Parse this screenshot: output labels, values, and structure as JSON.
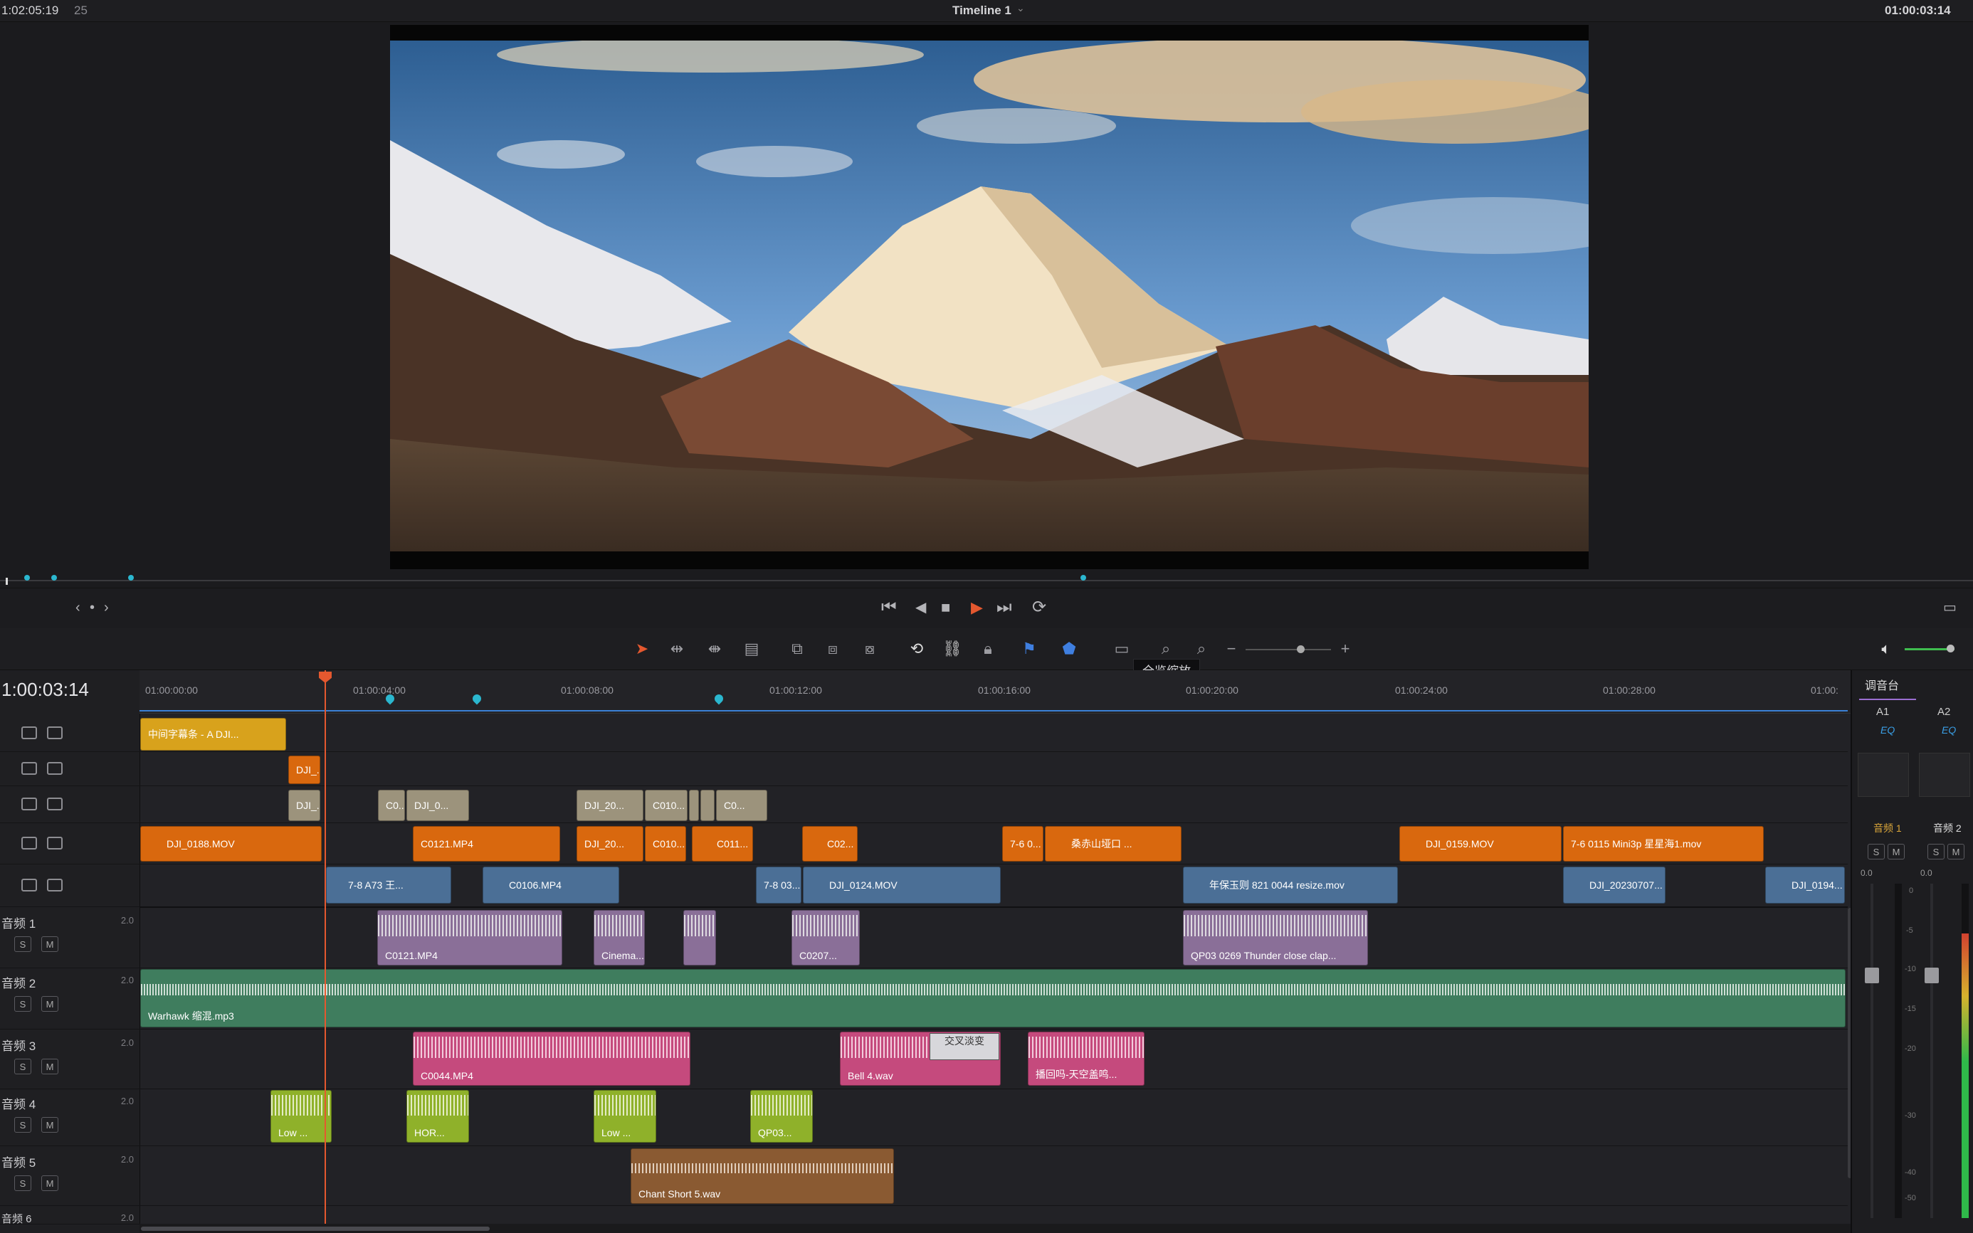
{
  "topbar": {
    "left_timecode": "1:02:05:19",
    "frame_count": "25",
    "timeline_name": "Timeline 1",
    "right_timecode": "01:00:03:14"
  },
  "viewer": {
    "image_description_icon": "mountain-landscape-image"
  },
  "transport": {
    "nav_prev": "‹",
    "nav_dot": "•",
    "nav_next": "›"
  },
  "tooltip": {
    "text": "全览缩放"
  },
  "timeline": {
    "current_timecode": "1:00:03:14",
    "ruler_ticks": [
      "01:00:00:00",
      "01:00:04:00",
      "01:00:08:00",
      "01:00:12:00",
      "01:00:16:00",
      "01:00:20:00",
      "01:00:24:00",
      "01:00:28:00",
      "01:00:"
    ],
    "video_clips": {
      "v5": [
        {
          "label": "中间字幕条 - A DJI..."
        }
      ],
      "v4": [
        {
          "label": "DJI_..."
        }
      ],
      "v3": [
        {
          "label": "DJI_..."
        },
        {
          "label": "C0..."
        },
        {
          "label": "DJI_0..."
        },
        {
          "label": "DJI_20..."
        },
        {
          "label": "C010..."
        },
        {
          "label": "C0..."
        }
      ],
      "v2": [
        {
          "label": "DJI_0188.MOV"
        },
        {
          "label": "C0121.MP4"
        },
        {
          "label": "DJI_20..."
        },
        {
          "label": "C010..."
        },
        {
          "label": "C011..."
        },
        {
          "label": "C02..."
        },
        {
          "label": "7-6 0..."
        },
        {
          "label": "桑赤山垭口 ..."
        },
        {
          "label": "DJI_0159.MOV"
        },
        {
          "label": "7-6 0115 Mini3p 星星海1.mov"
        }
      ],
      "v1": [
        {
          "label": "7-8 A73 王..."
        },
        {
          "label": "C0106.MP4"
        },
        {
          "label": "7-8 03..."
        },
        {
          "label": "DJI_0124.MOV"
        },
        {
          "label": "年保玉则 821 0044 resize.mov"
        },
        {
          "label": "DJI_20230707..."
        },
        {
          "label": "DJI_0194..."
        }
      ]
    },
    "audio_tracks": [
      {
        "name": "音频 1",
        "gain": "2.0",
        "clips": [
          {
            "label": "C0121.MP4"
          },
          {
            "label": "Cinema..."
          },
          {
            "label": ""
          },
          {
            "label": "C0207..."
          },
          {
            "label": "QP03 0269 Thunder close clap..."
          }
        ]
      },
      {
        "name": "音频 2",
        "gain": "2.0",
        "clips": [
          {
            "label": "Warhawk 缩混.mp3"
          }
        ]
      },
      {
        "name": "音频 3",
        "gain": "2.0",
        "clips": [
          {
            "label": "C0044.MP4"
          },
          {
            "label": "Bell 4.wav"
          },
          {
            "label": "播回吗-天空盖鸣..."
          }
        ],
        "overlay": "交叉淡变"
      },
      {
        "name": "音频 4",
        "gain": "2.0",
        "clips": [
          {
            "label": "Low ..."
          },
          {
            "label": "HOR..."
          },
          {
            "label": "Low ..."
          },
          {
            "label": "QP03..."
          }
        ]
      },
      {
        "name": "音频 5",
        "gain": "2.0",
        "clips": [
          {
            "label": "Chant Short 5.wav"
          }
        ]
      },
      {
        "name": "音频 6",
        "gain": "2.0",
        "clips": []
      }
    ],
    "solo_label": "S",
    "mute_label": "M"
  },
  "mixer": {
    "title": "调音台",
    "channels": [
      {
        "name": "A1",
        "eq": "EQ",
        "bus": "音频 1"
      },
      {
        "name": "A2",
        "eq": "EQ",
        "bus": "音频 2"
      }
    ],
    "gain_value": "0.0",
    "scale": [
      "0",
      "-5",
      "-10",
      "-15",
      "-20",
      "-30",
      "-40",
      "-50"
    ]
  },
  "colors": {
    "playhead": "#e4582f",
    "clip_orange": "#d9680e",
    "clip_yellow": "#d8a21c",
    "clip_tan": "#9c937c",
    "clip_blue": "#4b6f96",
    "clip_purple": "#8a6f98",
    "clip_green": "#3f7d5e",
    "clip_pink": "#c54a7d",
    "clip_lime": "#8fb12a",
    "clip_brown": "#8a5a32",
    "marker_cyan": "#2bb7cf"
  }
}
